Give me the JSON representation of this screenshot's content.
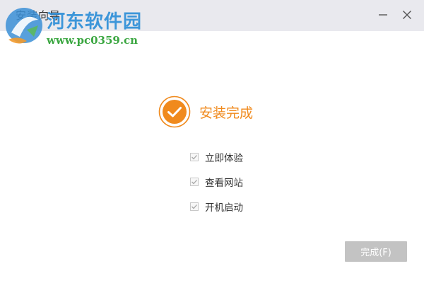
{
  "window": {
    "title": "安装向导"
  },
  "watermark": {
    "site_name": "河东软件园",
    "site_url": "www.pc0359.cn"
  },
  "status": {
    "icon": "check-circle-icon",
    "text": "安装完成",
    "accent_color": "#f08a1d"
  },
  "options": [
    {
      "label": "立即体验",
      "checked": true
    },
    {
      "label": "查看网站",
      "checked": true
    },
    {
      "label": "开机启动",
      "checked": true
    }
  ],
  "footer": {
    "finish_label": "完成(F)"
  }
}
